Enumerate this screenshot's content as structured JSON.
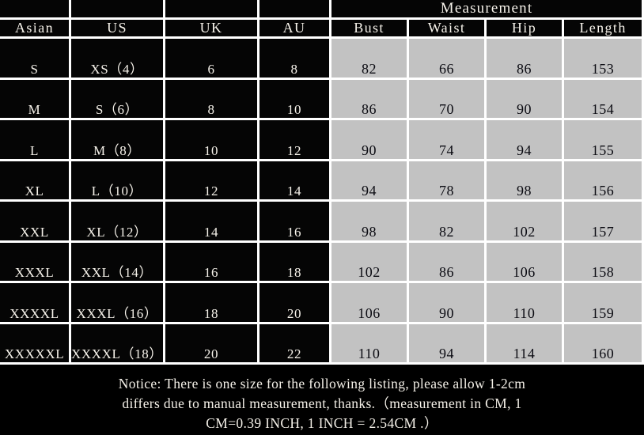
{
  "table": {
    "group_header": "Measurement",
    "size_columns": [
      "Asian",
      "US",
      "UK",
      "AU"
    ],
    "measure_columns": [
      "Bust",
      "Waist",
      "Hip",
      "Length"
    ],
    "rows": [
      {
        "asian": "S",
        "us": "XS（4）",
        "uk": "6",
        "au": "8",
        "bust": "82",
        "waist": "66",
        "hip": "86",
        "length": "153"
      },
      {
        "asian": "M",
        "us": "S（6）",
        "uk": "8",
        "au": "10",
        "bust": "86",
        "waist": "70",
        "hip": "90",
        "length": "154"
      },
      {
        "asian": "L",
        "us": "M（8）",
        "uk": "10",
        "au": "12",
        "bust": "90",
        "waist": "74",
        "hip": "94",
        "length": "155"
      },
      {
        "asian": "XL",
        "us": "L（10）",
        "uk": "12",
        "au": "14",
        "bust": "94",
        "waist": "78",
        "hip": "98",
        "length": "156"
      },
      {
        "asian": "XXL",
        "us": "XL（12）",
        "uk": "14",
        "au": "16",
        "bust": "98",
        "waist": "82",
        "hip": "102",
        "length": "157"
      },
      {
        "asian": "XXXL",
        "us": "XXL（14）",
        "uk": "16",
        "au": "18",
        "bust": "102",
        "waist": "86",
        "hip": "106",
        "length": "158"
      },
      {
        "asian": "XXXXL",
        "us": "XXXL（16）",
        "uk": "18",
        "au": "20",
        "bust": "106",
        "waist": "90",
        "hip": "110",
        "length": "159"
      },
      {
        "asian": "XXXXXL",
        "us": "XXXXL（18）",
        "uk": "20",
        "au": "22",
        "bust": "110",
        "waist": "94",
        "hip": "114",
        "length": "160"
      }
    ]
  },
  "notice": {
    "line1": "Notice: There  is one size for the following listing, please allow 1-2cm",
    "line2": "differs due to manual  measurement,    thanks.（measurement in CM, 1",
    "line3": "CM=0.39 INCH, 1 INCH = 2.54CM .）"
  },
  "colors": {
    "cell_dark": "#050505",
    "cell_gray": "#c2c2c2",
    "grid_line": "#ffffff",
    "text_light": "#f6f2ea",
    "text_dark": "#0b0b12"
  }
}
